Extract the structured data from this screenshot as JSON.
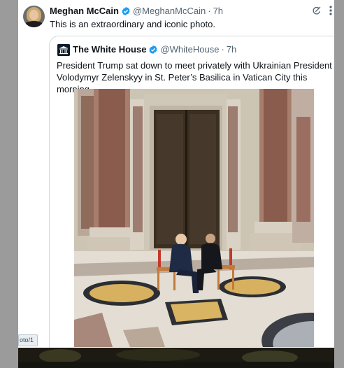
{
  "tweet": {
    "author_name": "Meghan McCain",
    "author_handle": "@MeghanMcCain",
    "time": "7h",
    "separator": "·",
    "text": "This is an extraordinary and iconic photo."
  },
  "quote": {
    "author_name": "The White House",
    "author_handle": "@WhiteHouse",
    "time": "7h",
    "separator": "·",
    "text": "President Trump sat down to meet privately with Ukrainian President Volodymyr Zelenskyy in St. Peter’s Basilica in Vatican City this morning."
  },
  "status_tooltip": {
    "text": "oto/1"
  },
  "colors": {
    "verified": "#1d9bf0",
    "text": "#0f1419",
    "secondary": "#536471",
    "border": "#cfd9de"
  },
  "icons": [
    "verified-badge-icon",
    "grok-icon",
    "more-options-icon",
    "white-house-logo"
  ]
}
